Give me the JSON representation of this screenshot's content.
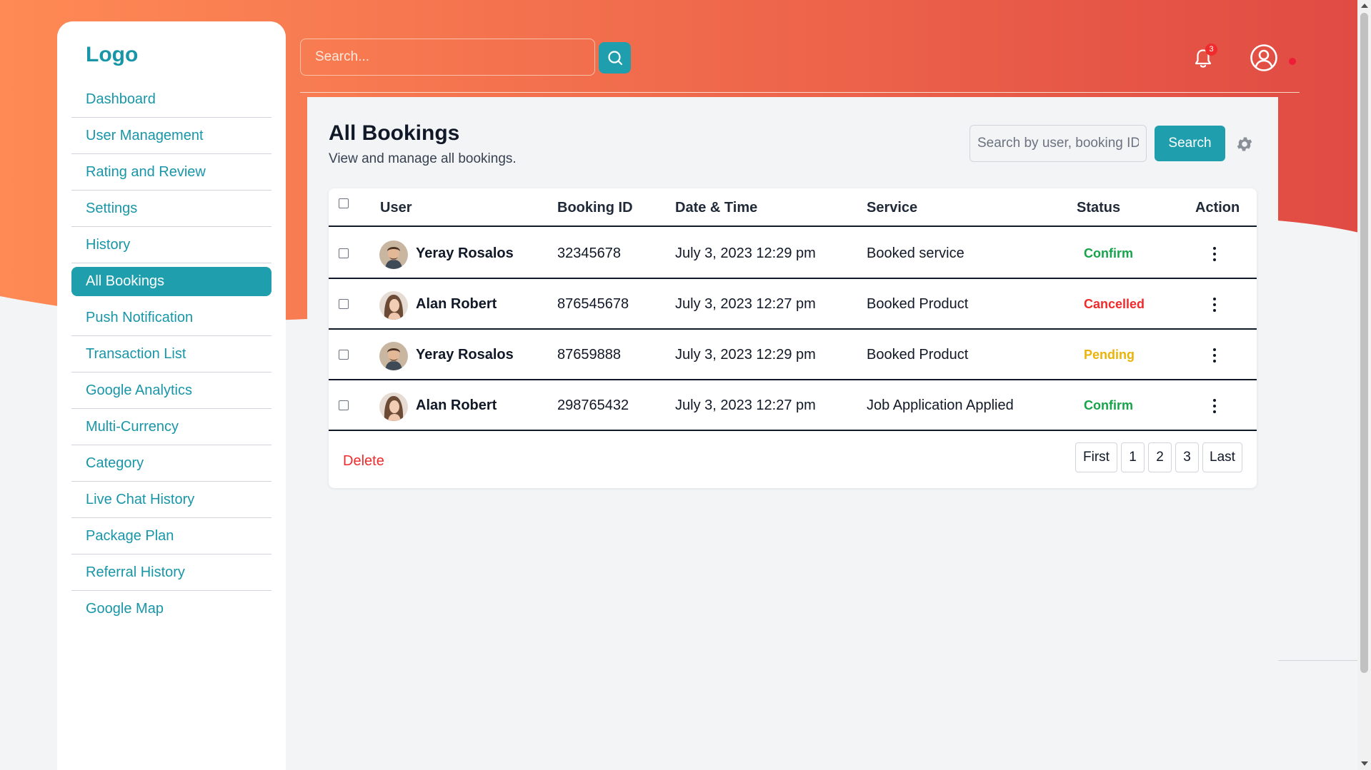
{
  "sidebar": {
    "logo": "Logo",
    "items": [
      {
        "label": "Dashboard"
      },
      {
        "label": "User Management"
      },
      {
        "label": "Rating and Review"
      },
      {
        "label": "Settings"
      },
      {
        "label": "History"
      },
      {
        "label": "All Bookings",
        "active": true
      },
      {
        "label": "Push Notification"
      },
      {
        "label": "Transaction List"
      },
      {
        "label": "Google Analytics"
      },
      {
        "label": "Multi-Currency"
      },
      {
        "label": "Category"
      },
      {
        "label": "Live Chat History"
      },
      {
        "label": "Package Plan"
      },
      {
        "label": "Referral History"
      },
      {
        "label": "Google Map"
      }
    ]
  },
  "topbar": {
    "search_placeholder": "Search...",
    "search_icon": "search-icon",
    "notification_count": "3",
    "bell_icon": "bell-icon",
    "user_icon": "user-circle-icon"
  },
  "page": {
    "title": "All Bookings",
    "subtitle": "View and manage all bookings.",
    "filter_placeholder": "Search by user, booking ID",
    "filter_button": "Search",
    "settings_icon": "gear-icon"
  },
  "table": {
    "columns": [
      "User",
      "Booking ID",
      "Date & Time",
      "Service",
      "Status",
      "Action"
    ],
    "rows": [
      {
        "user": "Yeray Rosalos",
        "avatar": "male",
        "booking_id": "32345678",
        "datetime": "July 3, 2023 12:29 pm",
        "service": "Booked service",
        "status": "Confirm"
      },
      {
        "user": "Alan Robert",
        "avatar": "female",
        "booking_id": "876545678",
        "datetime": "July 3, 2023 12:27 pm",
        "service": "Booked Product",
        "status": "Cancelled"
      },
      {
        "user": "Yeray Rosalos",
        "avatar": "male",
        "booking_id": "87659888",
        "datetime": "July 3, 2023 12:29 pm",
        "service": "Booked Product",
        "status": "Pending"
      },
      {
        "user": "Alan Robert",
        "avatar": "female",
        "booking_id": "298765432",
        "datetime": "July 3, 2023 12:27 pm",
        "service": "Job Application Applied",
        "status": "Confirm"
      }
    ],
    "delete_label": "Delete",
    "pagination": [
      "First",
      "1",
      "2",
      "3",
      "Last"
    ]
  },
  "colors": {
    "accent": "#1f9eae",
    "confirm": "#16a34a",
    "cancelled": "#ef2b2b",
    "pending": "#eab308",
    "hero_start": "#ff8a55",
    "hero_end": "#e04a43"
  }
}
